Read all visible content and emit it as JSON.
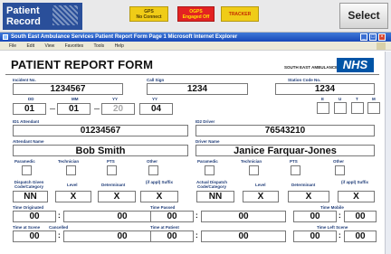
{
  "app": {
    "brand_line1": "Patient",
    "brand_line2": "Record",
    "chips": {
      "gps_title": "GPS",
      "gps_sub": "No Connect",
      "ogps_title": "OGPS",
      "ogps_sub": "Engaged Off",
      "tracker": "TRACKER"
    },
    "select_label": "Select"
  },
  "window": {
    "title": "South East Ambulance Services   Patient Report Form   Page 1   Microsoft Internet Explorer",
    "menu": [
      "File",
      "Edit",
      "View",
      "Favorites",
      "Tools",
      "Help"
    ]
  },
  "form": {
    "title": "PATIENT REPORT FORM",
    "service_name": "SOUTH EAST AMBULANCE SERVICES",
    "nhs_logo": "NHS",
    "labels": {
      "incident_no": "Incident No.",
      "call_sign": "Call Sign",
      "station_code": "Station Code No.",
      "dd": "DD",
      "mm": "MM",
      "yy1": "YY",
      "yy2": "YY",
      "e": "E",
      "u": "U",
      "t": "T",
      "m": "M",
      "id1_attendant": "ID1 Attendant",
      "id2_driver": "ID2 Driver",
      "attendant_name": "Attendant Name",
      "driver_name": "Driver Name",
      "paramedic": "Paramedic",
      "technician": "Technician",
      "pts": "PTS",
      "other": "Other",
      "dispatch_given": "Dispatch Given Code/Category",
      "level": "Level",
      "determinant": "Determinant",
      "suffix": "(if appl) Suffix",
      "actual_dispatch": "Actual Dispatch Code/Category",
      "time_originated": "Time Originated",
      "time_passed": "Time Passed",
      "time_mobile": "Time Mobile",
      "time_at_scene": "Time at Scene",
      "cancelled": "Cancelled",
      "time_at_patient": "Time at Patient",
      "time_left_scene": "Time Left Scene"
    },
    "values": {
      "incident_no": "1234567",
      "call_sign": "1234",
      "station_code": "1234",
      "dd": "01",
      "mm": "01",
      "yy1": "20",
      "yy2": "04",
      "id1_attendant": "01234567",
      "id2_driver": "76543210",
      "attendant_name": "Bob Smith",
      "driver_name": "Janice Farquar-Jones",
      "dispatch_given": "NN",
      "level": "X",
      "determinant": "X",
      "suffix": "X",
      "actual_dispatch": "NN",
      "level2": "X",
      "determinant2": "X",
      "suffix2": "X",
      "time_originated_h": "00",
      "time_originated_m": "00",
      "time_passed_h": "00",
      "time_passed_m": "00",
      "time_mobile_h": "00",
      "time_mobile_m": "00",
      "time_at_scene_h": "00",
      "time_at_scene_m": "00",
      "time_at_patient_h": "00",
      "time_at_patient_m": "00",
      "time_left_scene_h": "00",
      "time_left_scene_m": "00"
    }
  }
}
